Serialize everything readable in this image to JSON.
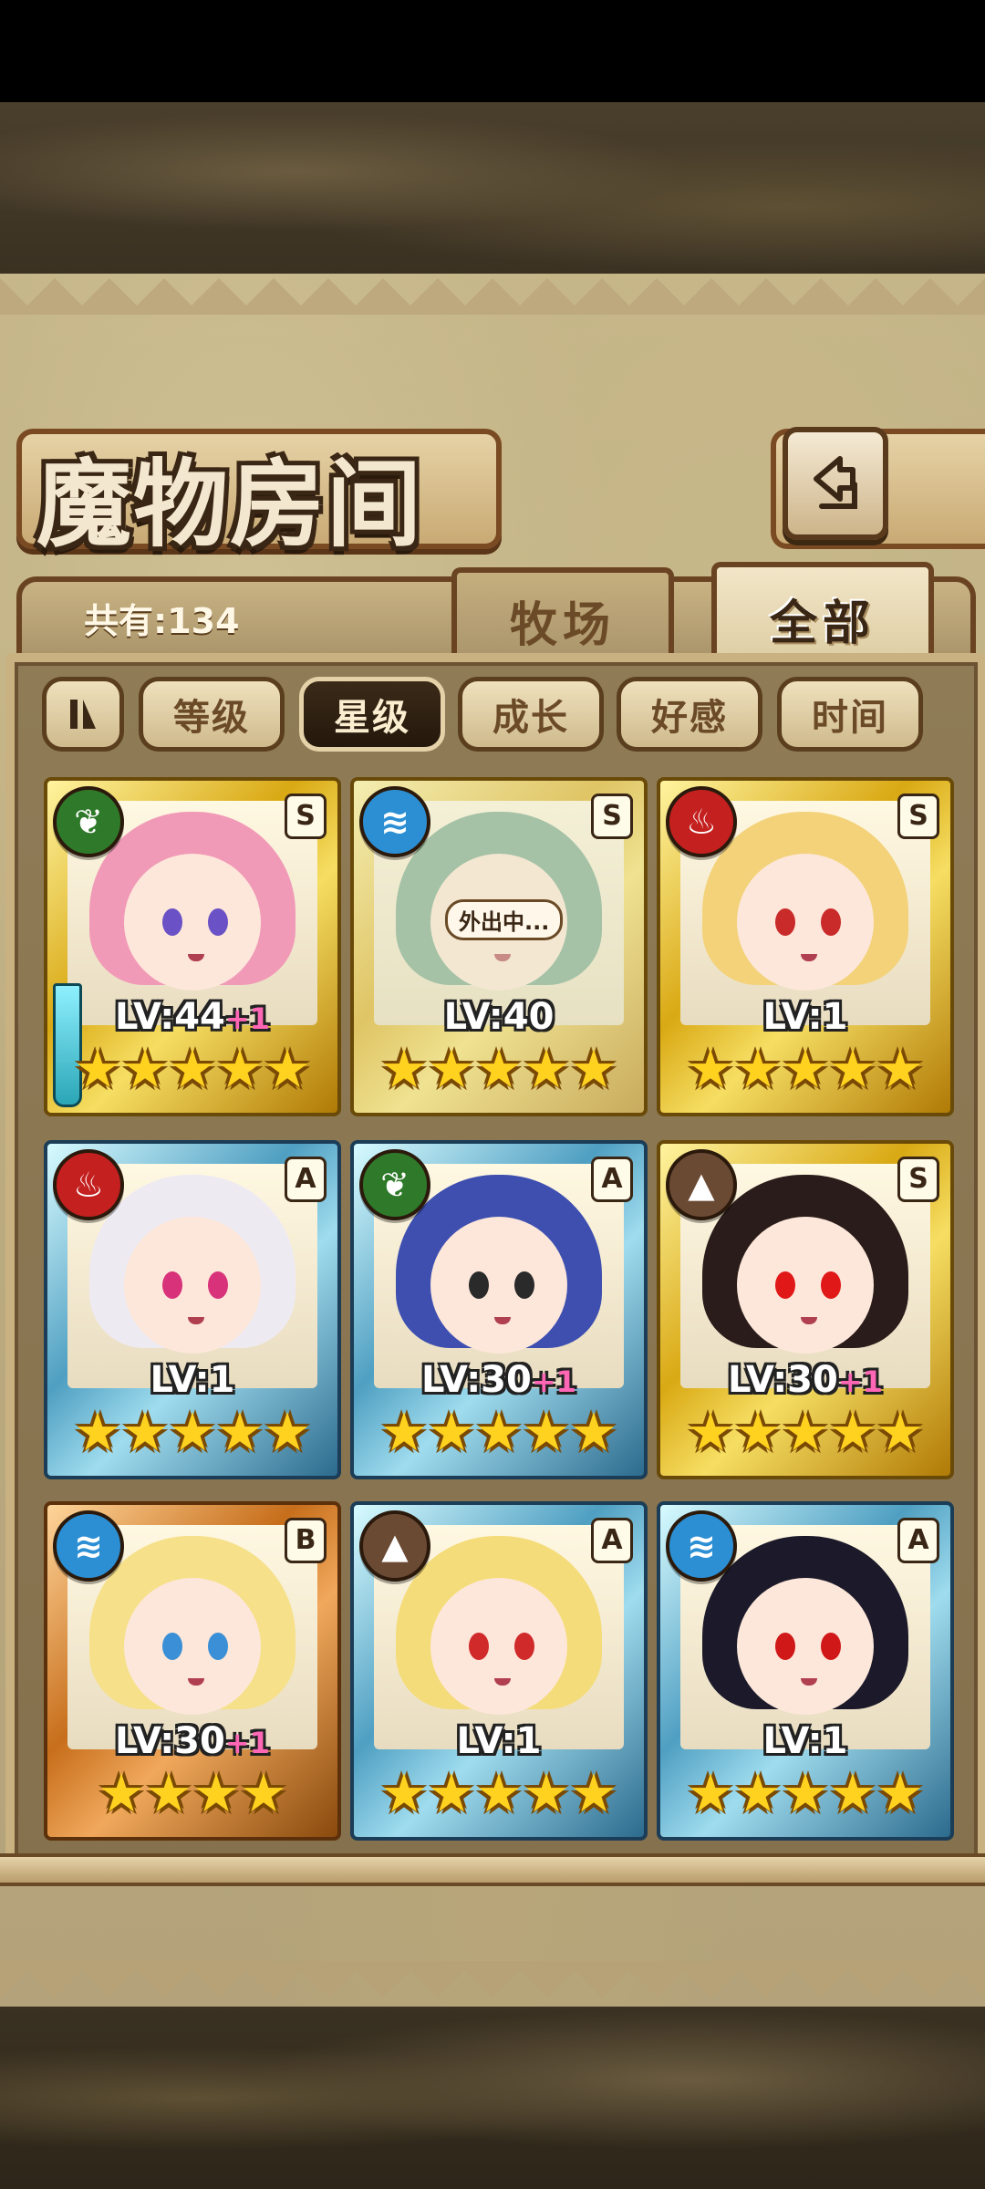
{
  "header": {
    "title": "魔物房间",
    "back_icon": "return-arrow-icon"
  },
  "tabs": {
    "count_label": "共有:134",
    "ranch": "牧场",
    "all": "全部",
    "active": "全部"
  },
  "filters": {
    "sort_icon": "sort-toggle-icon",
    "items": [
      "等级",
      "星级",
      "成长",
      "好感",
      "时间"
    ],
    "active": "星级"
  },
  "cards": [
    {
      "element": "leaf",
      "element_icon": "leaf-icon",
      "grade": "S",
      "frame": "gold",
      "level": "LV:44",
      "plus": "+1",
      "stars": "★★★★★",
      "hair": "#f19ab7",
      "eyes": "#6a52c6",
      "weapon": true
    },
    {
      "element": "water",
      "element_icon": "water-wave-icon",
      "grade": "S",
      "frame": "gold",
      "level": "LV:40",
      "plus": "",
      "stars": "★★★★★",
      "hair": "#6fa58a",
      "eyes": "#3a3a3a",
      "status": "外出中..."
    },
    {
      "element": "fire",
      "element_icon": "flame-icon",
      "grade": "S",
      "frame": "gold",
      "level": "LV:1",
      "plus": "",
      "stars": "★★★★★",
      "hair": "#f3d27a",
      "eyes": "#c92b2b"
    },
    {
      "element": "fire",
      "element_icon": "flame-icon",
      "grade": "A",
      "frame": "silver",
      "level": "LV:1",
      "plus": "",
      "stars": "★★★★★",
      "hair": "#eeeaf2",
      "eyes": "#d8327a"
    },
    {
      "element": "leaf",
      "element_icon": "leaf-icon",
      "grade": "A",
      "frame": "silver",
      "level": "LV:30",
      "plus": "+1",
      "stars": "★★★★★",
      "hair": "#3e4fb0",
      "eyes": "#2a2a2a"
    },
    {
      "element": "earth",
      "element_icon": "mountain-icon",
      "grade": "S",
      "frame": "gold",
      "level": "LV:30",
      "plus": "+1",
      "stars": "★★★★★",
      "hair": "#2a1c1a",
      "eyes": "#e01818"
    },
    {
      "element": "water",
      "element_icon": "water-wave-icon",
      "grade": "B",
      "frame": "bronze",
      "level": "LV:30",
      "plus": "+1",
      "stars": "★★★★",
      "hair": "#f6e08a",
      "eyes": "#3a8fd6"
    },
    {
      "element": "earth",
      "element_icon": "mountain-icon",
      "grade": "A",
      "frame": "silver",
      "level": "LV:1",
      "plus": "",
      "stars": "★★★★★",
      "hair": "#f5dc7a",
      "eyes": "#d02a2a"
    },
    {
      "element": "water",
      "element_icon": "water-wave-icon",
      "grade": "A",
      "frame": "silver",
      "level": "LV:1",
      "plus": "",
      "stars": "★★★★★",
      "hair": "#1c1a2a",
      "eyes": "#d01818"
    }
  ]
}
